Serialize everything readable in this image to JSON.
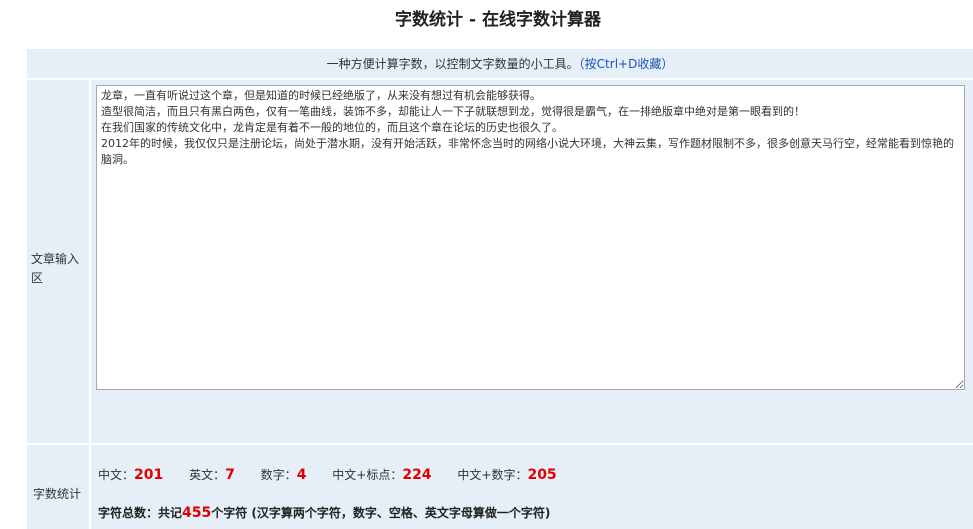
{
  "page": {
    "title": "字数统计 - 在线字数计算器"
  },
  "intro": {
    "text": "一种方便计算字数，以控制文字数量的小工具。",
    "link_text": "（按Ctrl+D收藏）"
  },
  "input_section": {
    "label": "文章输入区",
    "content": "龙章，一直有听说过这个章，但是知道的时候已经绝版了，从来没有想过有机会能够获得。\n造型很简洁，而且只有黑白两色，仅有一笔曲线，装饰不多，却能让人一下子就联想到龙，觉得很是霸气，在一排绝版章中绝对是第一眼看到的！\n在我们国家的传统文化中，龙肯定是有着不一般的地位的，而且这个章在论坛的历史也很久了。\n2012年的时候，我仅仅只是注册论坛，尚处于潜水期，没有开始活跃，非常怀念当时的网络小说大环境，大神云集，写作题材限制不多，很多创意天马行空，经常能看到惊艳的脑洞。"
  },
  "stats_section": {
    "label": "字数统计",
    "chinese_label": "中文：",
    "chinese_value": "201",
    "english_label": "英文：",
    "english_value": "7",
    "digits_label": "数字：",
    "digits_value": "4",
    "chinese_punct_label": "中文+标点：",
    "chinese_punct_value": "224",
    "chinese_digits_label": "中文+数字：",
    "chinese_digits_value": "205",
    "total_prefix": "字符总数：共记",
    "total_value": "455",
    "total_suffix": "个字符 (汉字算两个字符，数字、空格、英文字母算做一个字符)"
  }
}
